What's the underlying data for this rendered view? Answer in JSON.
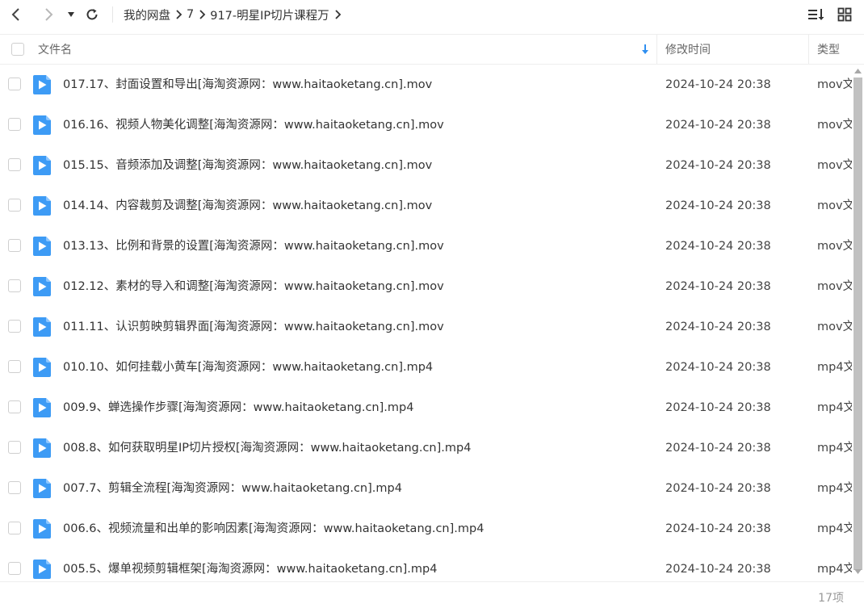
{
  "toolbar": {
    "breadcrumbs": [
      "我的网盘",
      "7",
      "917-明星IP切片课程万"
    ]
  },
  "columns": {
    "name": "文件名",
    "modified": "修改时间",
    "type": "类型"
  },
  "files": [
    {
      "name": "017.17、封面设置和导出[海淘资源网：www.haitaoketang.cn].mov",
      "time": "2024-10-24 20:38",
      "type": "mov文"
    },
    {
      "name": "016.16、视频人物美化调整[海淘资源网：www.haitaoketang.cn].mov",
      "time": "2024-10-24 20:38",
      "type": "mov文"
    },
    {
      "name": "015.15、音频添加及调整[海淘资源网：www.haitaoketang.cn].mov",
      "time": "2024-10-24 20:38",
      "type": "mov文"
    },
    {
      "name": "014.14、内容裁剪及调整[海淘资源网：www.haitaoketang.cn].mov",
      "time": "2024-10-24 20:38",
      "type": "mov文"
    },
    {
      "name": "013.13、比例和背景的设置[海淘资源网：www.haitaoketang.cn].mov",
      "time": "2024-10-24 20:38",
      "type": "mov文"
    },
    {
      "name": "012.12、素材的导入和调整[海淘资源网：www.haitaoketang.cn].mov",
      "time": "2024-10-24 20:38",
      "type": "mov文"
    },
    {
      "name": "011.11、认识剪映剪辑界面[海淘资源网：www.haitaoketang.cn].mov",
      "time": "2024-10-24 20:38",
      "type": "mov文"
    },
    {
      "name": "010.10、如何挂载小黄车[海淘资源网：www.haitaoketang.cn].mp4",
      "time": "2024-10-24 20:38",
      "type": "mp4文"
    },
    {
      "name": "009.9、蝉选操作步骤[海淘资源网：www.haitaoketang.cn].mp4",
      "time": "2024-10-24 20:38",
      "type": "mp4文"
    },
    {
      "name": "008.8、如何获取明星IP切片授权[海淘资源网：www.haitaoketang.cn].mp4",
      "time": "2024-10-24 20:38",
      "type": "mp4文"
    },
    {
      "name": "007.7、剪辑全流程[海淘资源网：www.haitaoketang.cn].mp4",
      "time": "2024-10-24 20:38",
      "type": "mp4文"
    },
    {
      "name": "006.6、视频流量和出单的影响因素[海淘资源网：www.haitaoketang.cn].mp4",
      "time": "2024-10-24 20:38",
      "type": "mp4文"
    },
    {
      "name": "005.5、爆单视频剪辑框架[海淘资源网：www.haitaoketang.cn].mp4",
      "time": "2024-10-24 20:38",
      "type": "mp4文"
    }
  ],
  "footer": {
    "count": "17项"
  },
  "icons": {
    "back": "back-arrow-icon",
    "forward": "forward-arrow-icon",
    "history": "history-dropdown-icon",
    "refresh": "refresh-icon",
    "sort": "sort-icon",
    "grid": "grid-view-icon",
    "file": "video-file-icon",
    "sort_desc": "sort-descending-arrow-icon"
  },
  "colors": {
    "accent": "#2f8ff0",
    "file_icon": "#3d9bf5",
    "text": "#333333",
    "muted": "#999999"
  }
}
